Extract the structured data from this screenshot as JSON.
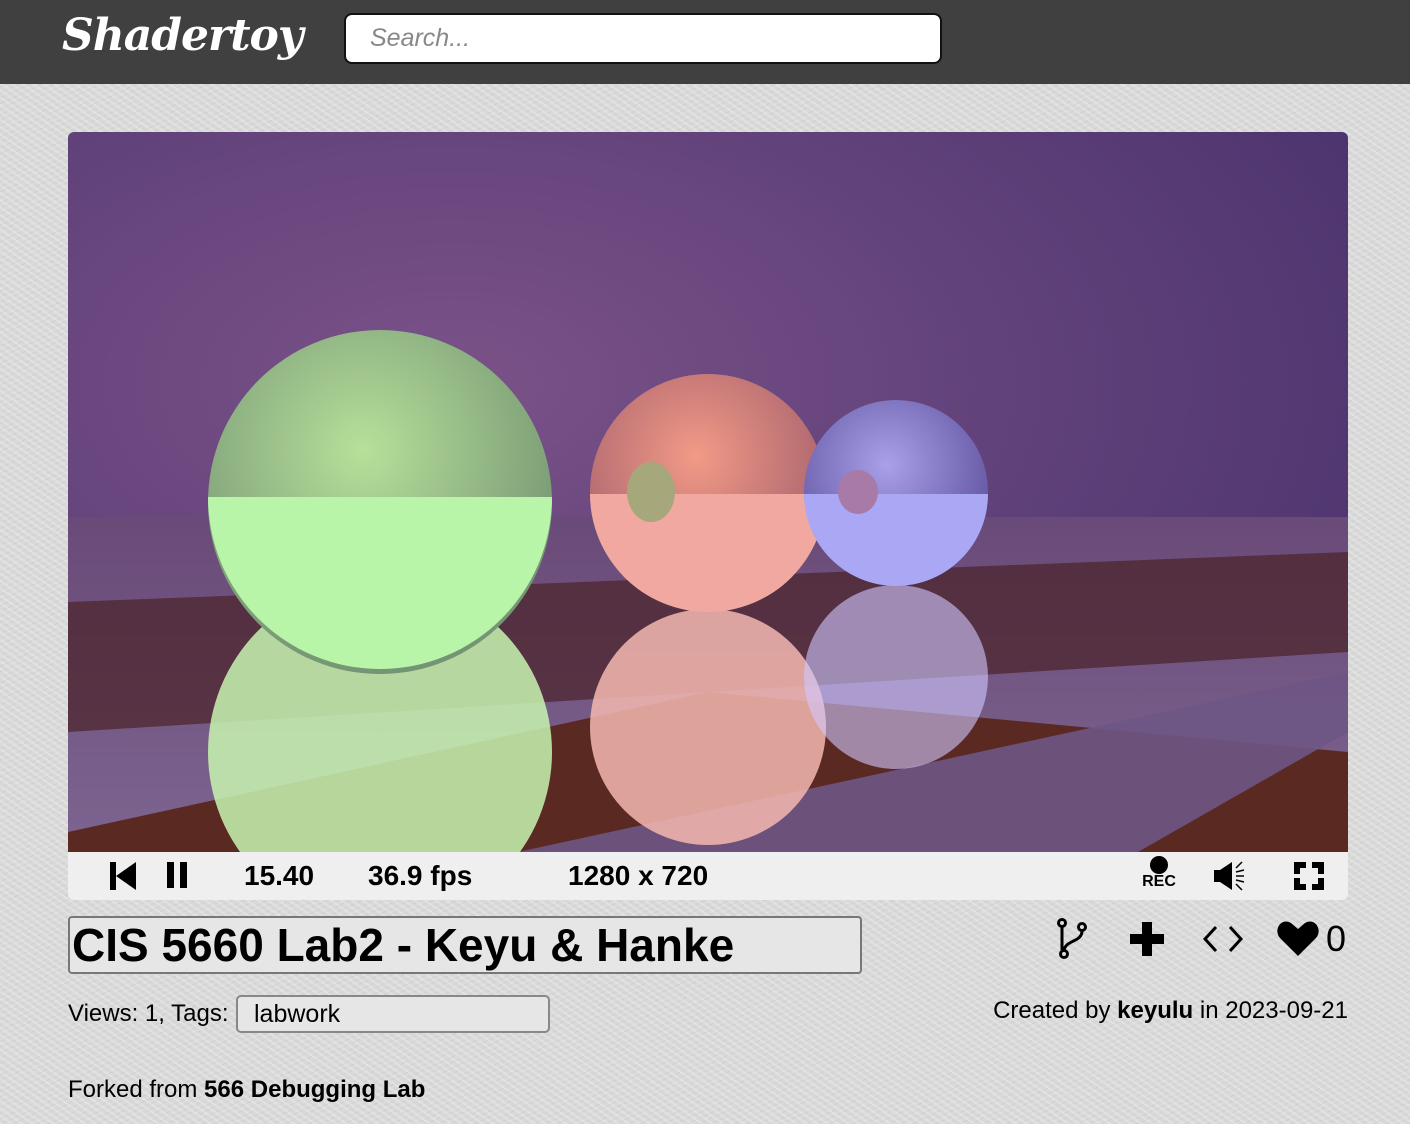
{
  "header": {
    "logo": "Shadertoy",
    "search_placeholder": "Search..."
  },
  "player": {
    "time": "15.40",
    "fps": "36.9 fps",
    "resolution": "1280 x 720",
    "rec_label": "REC"
  },
  "shader": {
    "title": "CIS 5660 Lab2 - Keyu & Hanke",
    "views_label": "Views: 1, Tags:",
    "tag": "labwork",
    "likes": "0",
    "created_prefix": "Created by",
    "author": "keyulu",
    "created_suffix": "in 2023-09-21",
    "forked_prefix": "Forked from",
    "forked_from": "566 Debugging Lab"
  }
}
